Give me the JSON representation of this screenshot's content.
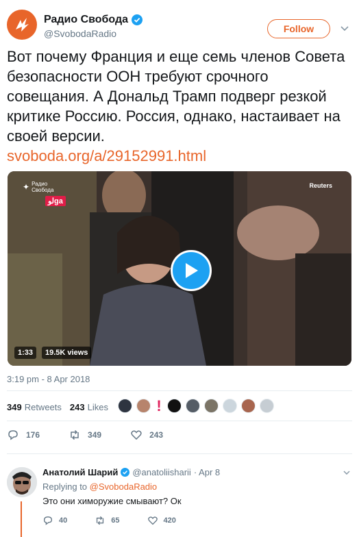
{
  "colors": {
    "brand": "#e8652a",
    "verified": "#1da1f2",
    "muted": "#657786",
    "play": "#1da1f2"
  },
  "tweet": {
    "author": "Радио Свобода",
    "handle": "@SvobodaRadio",
    "follow_label": "Follow",
    "text": "Вот почему Франция и еще семь членов Совета безопасности ООН требуют срочного совещания. А Дональд Трамп подверг резкой критике Россию. Россия, однако, настаивает на своей версии.",
    "link": "svoboda.org/a/29152991.html",
    "media": {
      "watermark_line1": "Радио",
      "watermark_line2": "Свобода",
      "channel_logo": "لوga",
      "credit": "Reuters",
      "duration": "1:33",
      "views": "19.5K views"
    },
    "timestamp": "3:19 pm - 8 Apr 2018",
    "retweets_count": "349",
    "retweets_label": "Retweets",
    "likes_count": "243",
    "likes_label": "Likes",
    "actions": {
      "replies": "176",
      "retweets": "349",
      "likes": "243"
    }
  },
  "reply": {
    "author": "Анатолий Шарий",
    "handle": "@anatoliisharii",
    "date": "· Apr 8",
    "replying_prefix": "Replying to",
    "replying_to": "@SvobodaRadio",
    "text": "Это они химоружие смывают? Ок",
    "actions": {
      "replies": "40",
      "retweets": "65",
      "likes": "420"
    }
  }
}
